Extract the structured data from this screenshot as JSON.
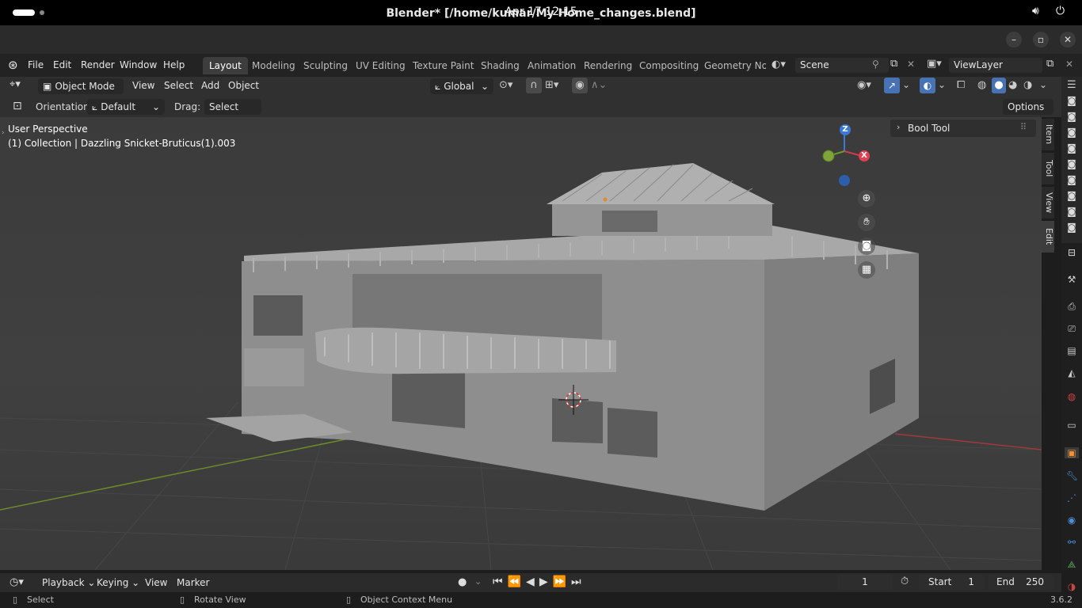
{
  "system": {
    "clock": "Apr 17  12:15",
    "volume_icon": "volume-icon",
    "power_icon": "power-icon"
  },
  "window": {
    "title": "Blender* [/home/kumar/My Home_changes.blend]",
    "minimize": "–",
    "maximize": "▫",
    "close": "✕"
  },
  "menubar": {
    "items": [
      "File",
      "Edit",
      "Render",
      "Window",
      "Help"
    ],
    "workspaces": [
      "Layout",
      "Modeling",
      "Sculpting",
      "UV Editing",
      "Texture Paint",
      "Shading",
      "Animation",
      "Rendering",
      "Compositing",
      "Geometry Noc"
    ],
    "scene": "Scene",
    "view_layer": "ViewLayer"
  },
  "viewport_header": {
    "mode": "Object Mode",
    "menus": [
      "View",
      "Select",
      "Add",
      "Object"
    ],
    "transform_orientation": "Global"
  },
  "tool_header": {
    "orientation_label": "Orientation:",
    "orientation_value": "Default",
    "drag_label": "Drag:",
    "drag_value": "Select Box",
    "options": "Options"
  },
  "viewport": {
    "perspective": "User Perspective",
    "collection_info": "(1) Collection | Dazzling Snicket-Bruticus(1).003",
    "axis_z": "Z",
    "axis_x": "X"
  },
  "sidebar": {
    "panel_title": "Bool Tool",
    "tabs": [
      "Item",
      "Tool",
      "View",
      "Edit"
    ]
  },
  "timeline": {
    "menus": [
      "Playback",
      "Keying",
      "View",
      "Marker"
    ],
    "current_frame": "1",
    "start_label": "Start",
    "start_value": "1",
    "end_label": "End",
    "end_value": "250"
  },
  "statusbar": {
    "select": "Select",
    "rotate": "Rotate View",
    "context_menu": "Object Context Menu",
    "version": "3.6.2"
  }
}
